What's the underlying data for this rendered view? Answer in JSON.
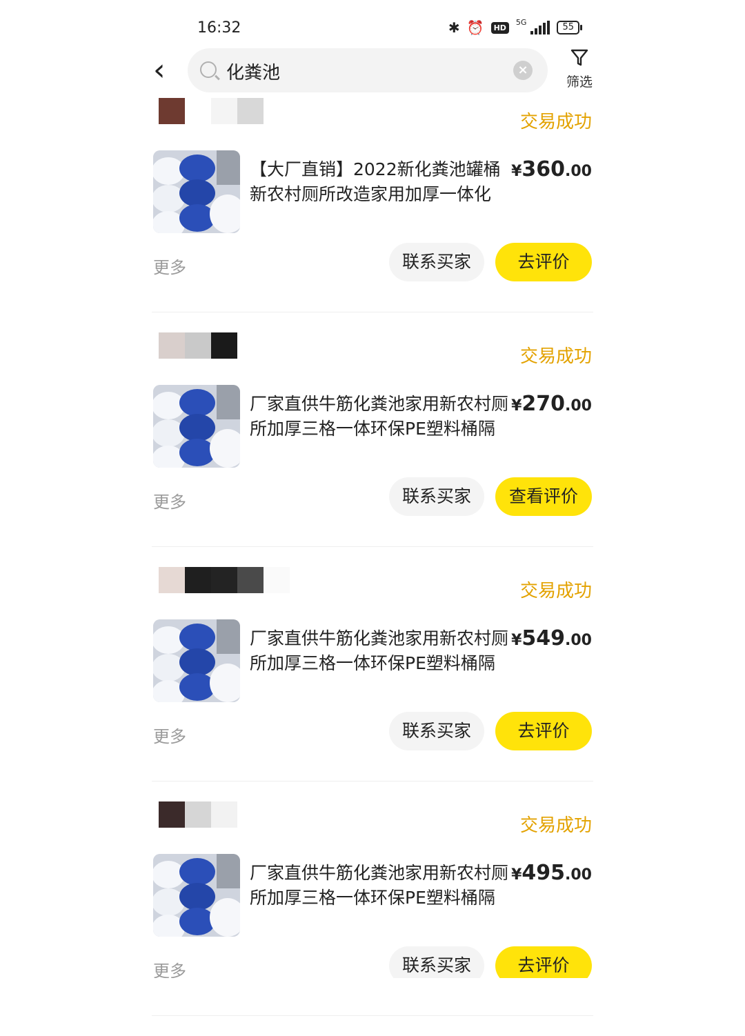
{
  "status_bar": {
    "time": "16:32",
    "network": "5G",
    "hd": "HD",
    "battery": "55"
  },
  "search": {
    "query": "化粪池",
    "clear_icon": "clear-icon",
    "filter_label": "筛选"
  },
  "orders": [
    {
      "state": "交易成功",
      "title": "【大厂直销】2022新化粪池罐桶新农村厕所改造家用加厚一体化",
      "price_symbol": "¥",
      "price_int": "360",
      "price_dec": ".00",
      "more": "更多",
      "contact_label": "联系买家",
      "action_label": "去评价",
      "avatar_colors": [
        "#6e3a30",
        "#ffffff",
        "#f4f4f4",
        "#d8d8d8"
      ]
    },
    {
      "state": "交易成功",
      "title": "厂家直供牛筋化粪池家用新农村厕所加厚三格一体环保PE塑料桶隔",
      "price_symbol": "¥",
      "price_int": "270",
      "price_dec": ".00",
      "more": "更多",
      "contact_label": "联系买家",
      "action_label": "查看评价",
      "avatar_colors": [
        "#d9cfcc",
        "#c9c9c9",
        "#1a1a1a"
      ]
    },
    {
      "state": "交易成功",
      "title": "厂家直供牛筋化粪池家用新农村厕所加厚三格一体环保PE塑料桶隔",
      "price_symbol": "¥",
      "price_int": "549",
      "price_dec": ".00",
      "more": "更多",
      "contact_label": "联系买家",
      "action_label": "去评价",
      "avatar_colors": [
        "#e6d9d4",
        "#1f1f1f",
        "#232323",
        "#4a4a4a",
        "#fafafa"
      ]
    },
    {
      "state": "交易成功",
      "title": "厂家直供牛筋化粪池家用新农村厕所加厚三格一体环保PE塑料桶隔",
      "price_symbol": "¥",
      "price_int": "495",
      "price_dec": ".00",
      "more": "更多",
      "contact_label": "联系买家",
      "action_label": "去评价",
      "avatar_colors": [
        "#3b2a2a",
        "#d6d6d6",
        "#f2f2f2",
        "#ffffff"
      ]
    }
  ],
  "colors": {
    "accent": "#ffe30a",
    "state": "#e3a200"
  }
}
